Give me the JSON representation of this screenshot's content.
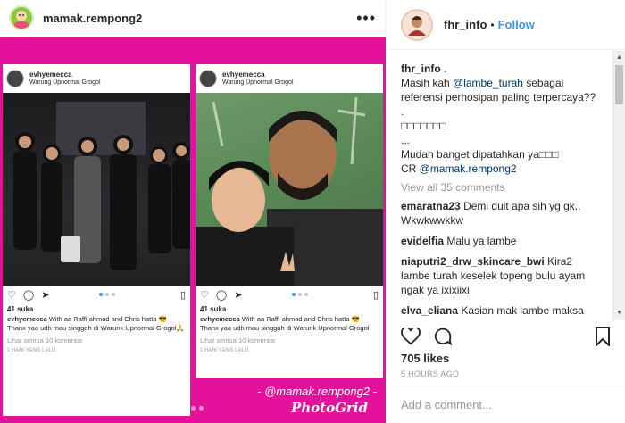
{
  "post": {
    "username": "mamak.rempong2",
    "more_label": "•••"
  },
  "collage": {
    "left_panel": {
      "username": "evhyemecca",
      "location": "Warung Upnormal Grogol",
      "likes": "41 suka",
      "caption_user": "evhyemecca",
      "caption_text": "With aa Raffi ahmad and Chris hatta 😎 Thanx yaa udh mau singgah di Warunk Upnormal Grogol🙏",
      "view_comments": "Lihat semua 10 komentar",
      "time": "1 HARI YANG LALU"
    },
    "right_panel": {
      "username": "evhyemecca",
      "location": "Warung Upnormal Grogol",
      "likes": "41 suka",
      "caption_user": "evhyemecca",
      "caption_text": "With aa Raffi ahmad and Chris hatta 😎 Thanx yaa udh mau singgah di Warunk Upnormal Grogol",
      "view_comments": "Lihat semua 10 komentar",
      "time": "1 HARI YANG LALU"
    },
    "watermark_handle": "- @mamak.rempong2 -",
    "watermark_brand": "PhotoGrid"
  },
  "side": {
    "username": "fhr_info",
    "separator": "•",
    "follow_label": "Follow",
    "caption": {
      "user": "fhr_info",
      "after_user": ".",
      "line1_prefix": "Masih kah ",
      "line1_mention": "@lambe_turah",
      "line1_suffix": " sebagai",
      "line2": "referensi perhosipan paling terpercaya??",
      "line3": ".",
      "line4": "□□□□□□□",
      "line5": "...",
      "line6": "Mudah banget dipatahkan ya□□□",
      "line7_prefix": "CR ",
      "line7_mention": "@mamak.rempong2"
    },
    "view_all_comments": "View all 35 comments",
    "comments": [
      {
        "user": "emaratna23",
        "text": "Demi duit apa sih yg gk.. Wkwkwwkkw"
      },
      {
        "user": "evidelfia",
        "text": "Malu ya lambe"
      },
      {
        "user": "niaputri2_drw_skincare_bwi",
        "text": "Kira2 lambe turah keselek topeng bulu ayam ngak ya ixixiixi"
      },
      {
        "user": "elva_eliana",
        "text": "Kasian mak lambe maksa bener mau buktiin kak ayu sm si onoh hahs duh penasaran sm mak lambe kebidupan nyata nya kayak apa sih sampai"
      }
    ],
    "likes": "705 likes",
    "time": "5 HOURS AGO",
    "comment_placeholder": "Add a comment..."
  },
  "icons": {
    "like": "heart-icon",
    "comment": "comment-bubble-icon",
    "share": "share-arrow-icon",
    "save": "bookmark-icon"
  },
  "colors": {
    "collage_bg": "#e3119b",
    "follow": "#3897f0",
    "mention": "#003569",
    "muted": "#999999"
  }
}
